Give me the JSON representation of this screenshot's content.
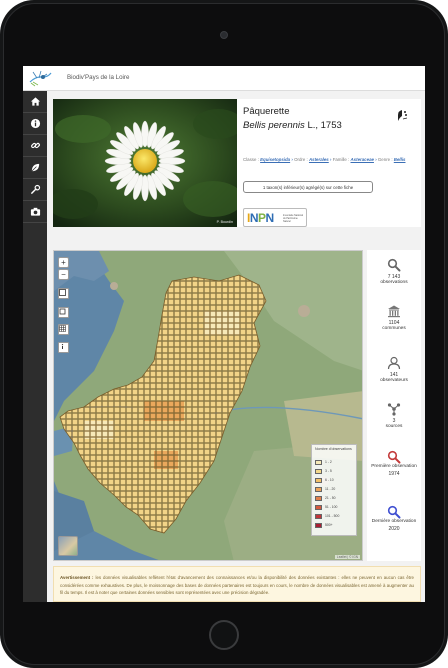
{
  "site": {
    "title": "Biodiv'Pays de la Loire"
  },
  "sidebar": {
    "items": [
      {
        "name": "home",
        "icon": "home-icon"
      },
      {
        "name": "info",
        "icon": "info-icon"
      },
      {
        "name": "link",
        "icon": "link-icon"
      },
      {
        "name": "leaf",
        "icon": "leaf-icon"
      },
      {
        "name": "tools",
        "icon": "wrench-icon"
      },
      {
        "name": "camera",
        "icon": "camera-icon"
      }
    ]
  },
  "species": {
    "common_name": "Pâquerette",
    "scientific_name": "Bellis perennis",
    "author": "L., 1753",
    "photo_credit": "P. Bourdin",
    "taxonomy": {
      "classe_label": "Classe :",
      "classe": "Equisetopsida",
      "ordre_label": "Ordre :",
      "ordre": "Asterales",
      "famille_label": "Famille :",
      "famille": "Asteraceae",
      "genre_label": "Genre :",
      "genre": "Bellis"
    },
    "subtaxa_button": "1 taxon(s) inférieur(s) agrégé(s) sur cette fiche",
    "inpn_logo": "INPN"
  },
  "map": {
    "zoom_in": "+",
    "zoom_out": "−",
    "legend_title": "Nombre d'observations",
    "legend": [
      {
        "label": "1 - 2",
        "color": "#f6eab8"
      },
      {
        "label": "3 - 5",
        "color": "#f4d98a"
      },
      {
        "label": "6 - 10",
        "color": "#f2c26a"
      },
      {
        "label": "11 - 20",
        "color": "#eda55a"
      },
      {
        "label": "21 - 50",
        "color": "#e2804a"
      },
      {
        "label": "51 - 100",
        "color": "#d45a3e"
      },
      {
        "label": "101 - 500",
        "color": "#c1353a"
      },
      {
        "label": "500+",
        "color": "#a91e34"
      }
    ],
    "attribution": "Leaflet | © IGN"
  },
  "stats": [
    {
      "icon": "search-icon",
      "value": "7 143",
      "label": "observations"
    },
    {
      "icon": "town-hall-icon",
      "value": "1104",
      "label": "communes"
    },
    {
      "icon": "user-icon",
      "value": "141",
      "label": "observateurs"
    },
    {
      "icon": "network-icon",
      "value": "3",
      "label": "sources"
    },
    {
      "icon": "search-red-icon",
      "value": "1974",
      "label": "Première observation"
    },
    {
      "icon": "search-blue-icon",
      "value": "2020",
      "label": "Dernière observation"
    }
  ],
  "warning": {
    "title": "Avertissement :",
    "text": "les données visualisables reflètent l'état d'avancement des connaissances et/ou la disponibilité des données existantes : elles ne peuvent en aucun cas être considérées comme exhaustives. De plus, le moissonnage des bases de données partenaires est toujours en cours, le nombre de données visualisables est amené à augmenter au fil du temps. Il est à noter que certaines données sensibles sont représentées avec une précision dégradée."
  }
}
